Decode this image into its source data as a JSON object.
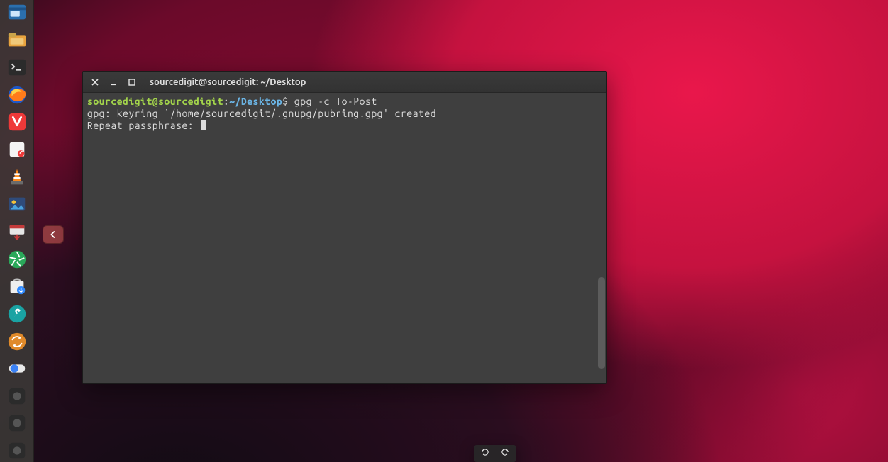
{
  "dock": {
    "items": [
      {
        "name": "files-icon"
      },
      {
        "name": "files-alt-icon"
      },
      {
        "name": "terminal-icon"
      },
      {
        "name": "firefox-icon"
      },
      {
        "name": "vivaldi-icon"
      },
      {
        "name": "notes-icon"
      },
      {
        "name": "vlc-icon"
      },
      {
        "name": "media-icon"
      },
      {
        "name": "software-updater-icon"
      },
      {
        "name": "shutter-icon"
      },
      {
        "name": "software-install-icon"
      },
      {
        "name": "settings-icon"
      },
      {
        "name": "sync-icon"
      },
      {
        "name": "tweaks-icon"
      },
      {
        "name": "item-15-icon"
      },
      {
        "name": "item-16-icon"
      },
      {
        "name": "item-17-icon"
      }
    ]
  },
  "terminal": {
    "title": "sourcedigit@sourcedigit: ~/Desktop",
    "prompt": {
      "user": "sourcedigit",
      "at": "@",
      "host": "sourcedigit",
      "colon": ":",
      "cwd": "~/Desktop",
      "dollar": "$"
    },
    "command": " gpg -c To-Post",
    "lines": {
      "l1": "gpg: keyring `/home/sourcedigit/.gnupg/pubring.gpg' created",
      "l2": "Repeat passphrase: "
    }
  },
  "colors": {
    "prompt_user": "#a3d44b",
    "prompt_cwd": "#6bb5e6",
    "term_bg": "#3f3f3f",
    "term_text": "#dcdcdc"
  }
}
